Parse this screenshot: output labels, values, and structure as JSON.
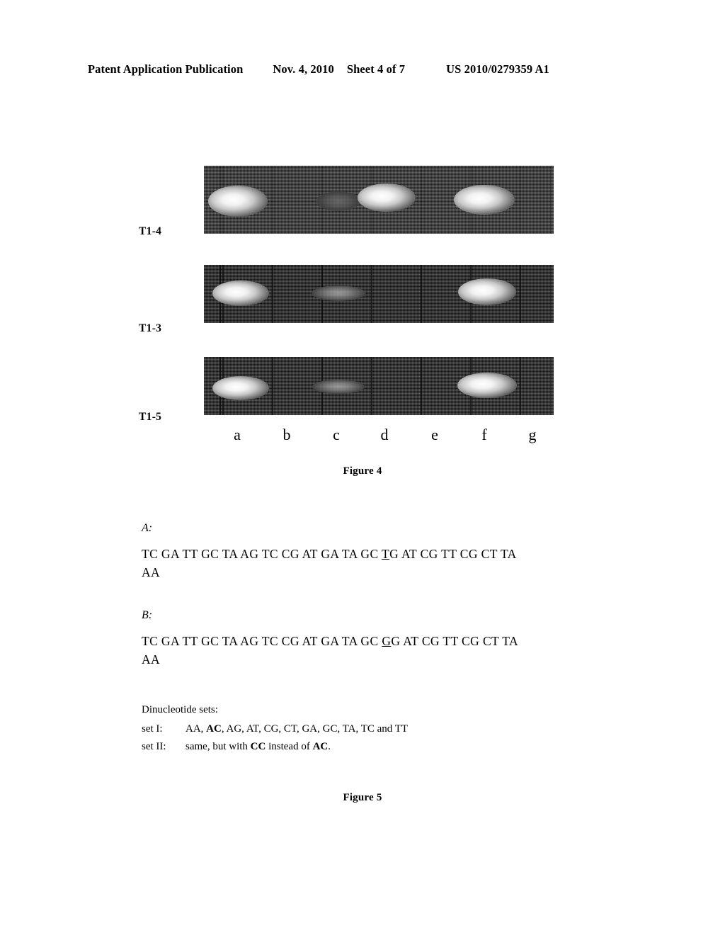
{
  "header": {
    "publication": "Patent Application Publication",
    "date": "Nov. 4, 2010",
    "sheet": "Sheet 4 of 7",
    "publication_number": "US 2010/0279359 A1"
  },
  "figure4": {
    "caption": "Figure 4",
    "panels": [
      {
        "label": "T1-4"
      },
      {
        "label": "T1-3"
      },
      {
        "label": "T1-5"
      }
    ],
    "lane_letters": [
      "a",
      "b",
      "c",
      "d",
      "e",
      "f",
      "g"
    ]
  },
  "figure5": {
    "caption": "Figure 5",
    "sequence_a": {
      "tag": "A:",
      "line1_before": "TC  GA  TT  GC  TA  AG  TC  CG  AT  GA  TA  GC  ",
      "line1_underlined": "T",
      "line1_after": "G  AT  CG  TT  CG  CT  TA",
      "line2": "AA"
    },
    "sequence_b": {
      "tag": "B:",
      "line1_before": "TC  GA  TT  GC  TA  AG  TC  CG  AT  GA  TA  GC  ",
      "line1_underlined": "G",
      "line1_after": "G  AT  CG  TT  CG  CT  TA",
      "line2": "AA"
    },
    "dinucleotide": {
      "title": "Dinucleotide sets:",
      "set1_key": "set I:",
      "set1_before": "AA,  ",
      "set1_bold": "AC",
      "set1_after": ",  AG,  AT,  CG,  CT,  GA,  GC,  TA,  TC  and  TT",
      "set2_key": "set II:",
      "set2_before": "same, but with ",
      "set2_bold1": "CC",
      "set2_middle": " instead of ",
      "set2_bold2": "AC",
      "set2_after": "."
    }
  }
}
